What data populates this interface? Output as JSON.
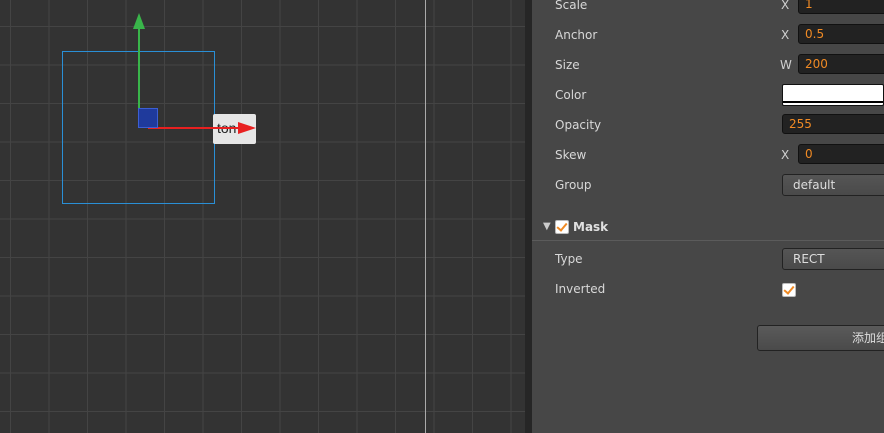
{
  "scene": {
    "button_text": "ton"
  },
  "inspector": {
    "properties": [
      {
        "label": "Scale",
        "axis": "X",
        "value": "1"
      },
      {
        "label": "Anchor",
        "axis": "X",
        "value": "0.5"
      },
      {
        "label": "Size",
        "axis": "W",
        "value": "200"
      },
      {
        "label": "Color"
      },
      {
        "label": "Opacity",
        "value": "255"
      },
      {
        "label": "Skew",
        "axis": "X",
        "value": "0"
      },
      {
        "label": "Group",
        "value": "default"
      }
    ],
    "mask": {
      "title": "Mask",
      "enabled": true,
      "type_label": "Type",
      "type_value": "RECT",
      "inverted_label": "Inverted",
      "inverted": true
    },
    "add_component_label": "添加组件",
    "colors": {
      "accent": "#f08a24",
      "selection": "#2a8fd6",
      "gizmo_x": "#e82020",
      "gizmo_y": "#39b54a",
      "gizmo_center": "#1f3a9c"
    }
  }
}
